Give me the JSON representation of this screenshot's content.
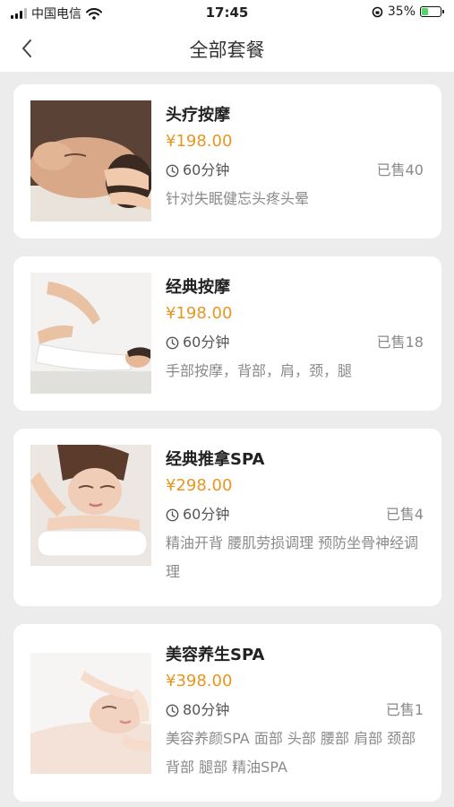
{
  "status_bar": {
    "carrier": "中国电信",
    "time": "17:45",
    "battery_percent": "35%",
    "battery_level": 0.35
  },
  "nav": {
    "back_icon": "chevron-left-icon",
    "title": "全部套餐"
  },
  "packages": [
    {
      "name": "头疗按摩",
      "price": "¥198.00",
      "duration": "60分钟",
      "sold": "已售40",
      "description": "针对失眠健忘头疼头晕",
      "image": "head-massage-photo"
    },
    {
      "name": "经典按摩",
      "price": "¥198.00",
      "duration": "60分钟",
      "sold": "已售18",
      "description": "手部按摩，背部，肩，颈，腿",
      "image": "back-massage-photo"
    },
    {
      "name": "经典推拿SPA",
      "price": "¥298.00",
      "duration": "60分钟",
      "sold": "已售4",
      "description": "精油开背 腰肌劳损调理 预防坐骨神经调理",
      "image": "spa-massage-photo"
    },
    {
      "name": "美容养生SPA",
      "price": "¥398.00",
      "duration": "80分钟",
      "sold": "已售1",
      "description": "美容养颜SPA 面部 头部 腰部 肩部 颈部 背部 腿部 精油SPA",
      "image": "facial-spa-photo"
    }
  ],
  "colors": {
    "price": "#e8961e",
    "background": "#ececec",
    "card": "#ffffff"
  }
}
